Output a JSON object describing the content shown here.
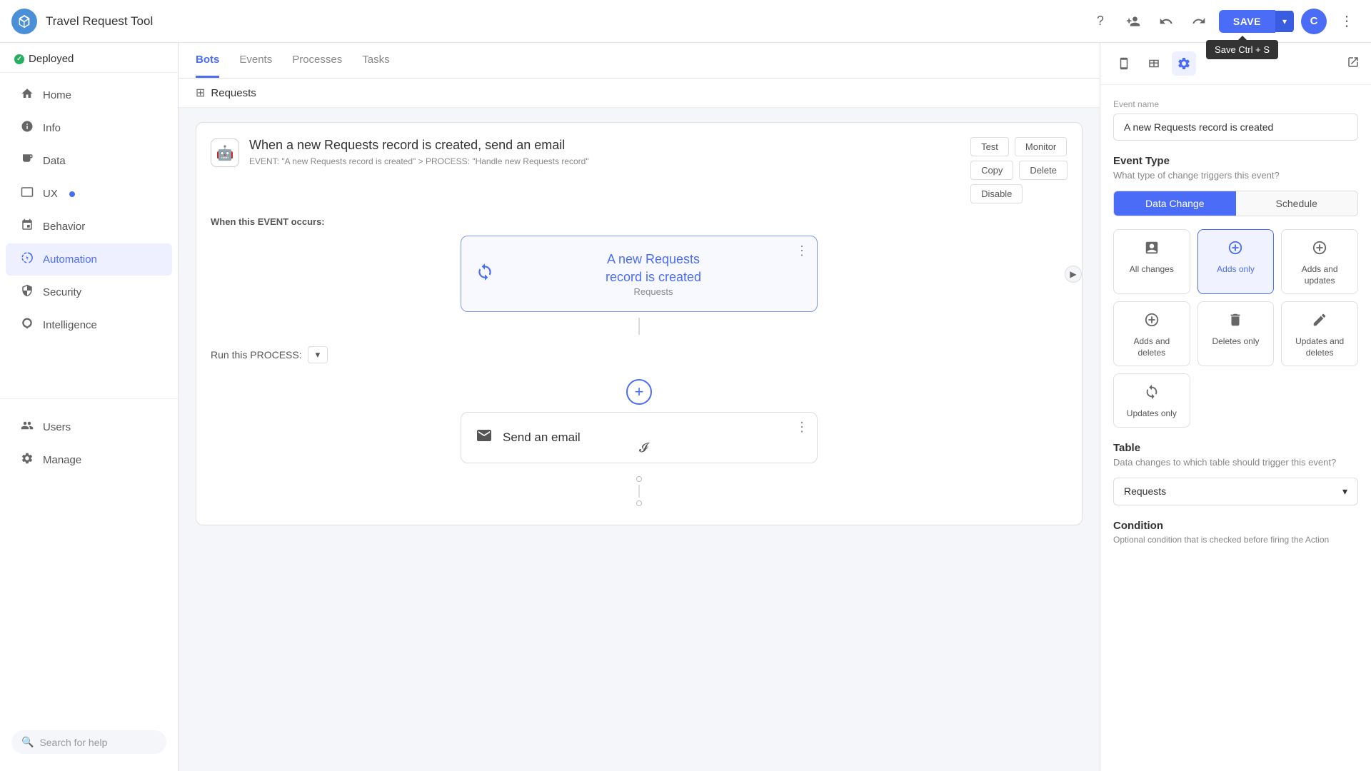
{
  "header": {
    "app_logo_alt": "Travel Request Tool Logo",
    "app_title": "Travel Request Tool",
    "help_icon": "?",
    "add_user_icon": "+person",
    "undo_icon": "↩",
    "redo_icon": "↪",
    "save_label": "SAVE",
    "save_tooltip": "Save Ctrl + S",
    "avatar_label": "C",
    "kebab_icon": "⋮"
  },
  "sidebar": {
    "deployed_label": "Deployed",
    "nav_items": [
      {
        "id": "home",
        "label": "Home",
        "icon": "⌂",
        "active": false
      },
      {
        "id": "info",
        "label": "Info",
        "icon": "ℹ",
        "active": false
      },
      {
        "id": "data",
        "label": "Data",
        "icon": "○",
        "active": false
      },
      {
        "id": "ux",
        "label": "UX",
        "icon": "◻",
        "active": false,
        "dot": true
      },
      {
        "id": "behavior",
        "label": "Behavior",
        "icon": "⊕",
        "active": false
      },
      {
        "id": "automation",
        "label": "Automation",
        "icon": "⚡",
        "active": true
      },
      {
        "id": "security",
        "label": "Security",
        "icon": "◯",
        "active": false
      },
      {
        "id": "intelligence",
        "label": "Intelligence",
        "icon": "◯",
        "active": false
      }
    ],
    "divider": true,
    "nav_items2": [
      {
        "id": "users",
        "label": "Users",
        "icon": "👤",
        "active": false
      },
      {
        "id": "manage",
        "label": "Manage",
        "icon": "⚙",
        "active": false
      }
    ],
    "search_placeholder": "Search for help"
  },
  "tabs": [
    {
      "id": "bots",
      "label": "Bots",
      "active": true
    },
    {
      "id": "events",
      "label": "Events",
      "active": false
    },
    {
      "id": "processes",
      "label": "Processes",
      "active": false
    },
    {
      "id": "tasks",
      "label": "Tasks",
      "active": false
    }
  ],
  "breadcrumb": {
    "icon": "⊞",
    "label": "Requests"
  },
  "automation_card": {
    "title": "When a new Requests record is created, send an email",
    "subtitle": "EVENT: \"A new Requests record is created\" > PROCESS: \"Handle new Requests record\"",
    "robot_icon": "🤖",
    "actions": {
      "test": "Test",
      "monitor": "Monitor",
      "copy": "Copy",
      "delete": "Delete",
      "disable": "Disable"
    }
  },
  "event_section": {
    "label_prefix": "When this ",
    "label_bold": "EVENT",
    "label_suffix": " occurs:",
    "event_box": {
      "title_line1": "A new Requests",
      "title_line2": "record is created",
      "subtitle": "Requests",
      "menu_icon": "⋮"
    }
  },
  "process_section": {
    "label": "Run this PROCESS:",
    "dropdown_icon": "▾"
  },
  "add_step": {
    "icon": "+"
  },
  "action_box": {
    "label": "Send an email",
    "icon": "✉",
    "menu_icon": "⋮"
  },
  "right_panel": {
    "toolbar": {
      "mobile_icon": "📱",
      "layout_icon": "⊞",
      "settings_icon": "⚙",
      "external_icon": "⬡"
    },
    "event_name_label": "Event name",
    "event_name_value": "A new Requests record is created",
    "event_type_section": {
      "title": "Event Type",
      "subtitle": "What type of change triggers this event?",
      "tabs": [
        {
          "id": "data_change",
          "label": "Data Change",
          "active": true
        },
        {
          "id": "schedule",
          "label": "Schedule",
          "active": false
        }
      ]
    },
    "change_types": [
      {
        "id": "all_changes",
        "icon": "⊕",
        "label": "All changes",
        "selected": false
      },
      {
        "id": "adds_only",
        "icon": "⊕",
        "label": "Adds only",
        "selected": true
      },
      {
        "id": "adds_and_updates",
        "icon": "⊕",
        "label": "Adds and updates",
        "selected": false
      },
      {
        "id": "adds_and_deletes",
        "icon": "⊕",
        "label": "Adds and deletes",
        "selected": false
      },
      {
        "id": "deletes_only",
        "icon": "🗑",
        "label": "Deletes only",
        "selected": false
      },
      {
        "id": "updates_and_deletes",
        "icon": "≡",
        "label": "Updates and deletes",
        "selected": false
      },
      {
        "id": "updates_only",
        "icon": "↺",
        "label": "Updates only",
        "selected": false
      }
    ],
    "table_section": {
      "title": "Table",
      "subtitle": "Data changes to which table should trigger this event?",
      "value": "Requests",
      "dropdown_icon": "▾"
    },
    "condition_section": {
      "title": "Condition",
      "subtitle": "Optional condition that is checked before firing the Action"
    }
  }
}
